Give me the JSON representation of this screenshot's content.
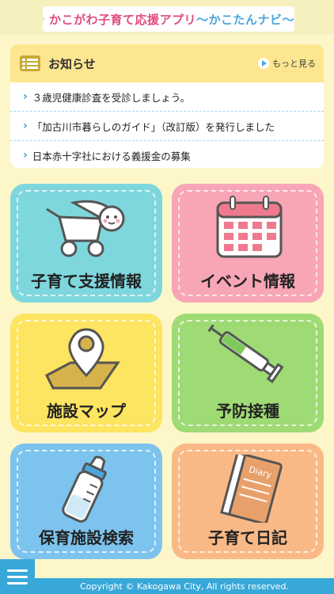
{
  "header": {
    "logo_main": "かこがわ子育て応援アプリ",
    "logo_sub": "〜かこたんナビ〜"
  },
  "notice": {
    "title": "お知らせ",
    "more_label": "もっと見る",
    "items": [
      {
        "text": "３歳児健康診査を受診しましょう。"
      },
      {
        "text": "「加古川市暮らしのガイド」（改訂版）を発行しました"
      },
      {
        "text": "日本赤十字社における義援金の募集"
      }
    ]
  },
  "tiles": [
    {
      "label": "子育て支援情報",
      "icon": "stroller-icon",
      "color": "#7ed7dd"
    },
    {
      "label": "イベント情報",
      "icon": "calendar-icon",
      "color": "#f8a5b6"
    },
    {
      "label": "施設マップ",
      "icon": "map-pin-icon",
      "color": "#fde461"
    },
    {
      "label": "予防接種",
      "icon": "syringe-icon",
      "color": "#9fdb75"
    },
    {
      "label": "保育施設検索",
      "icon": "baby-bottle-icon",
      "color": "#7cc3ee"
    },
    {
      "label": "子育て日記",
      "icon": "diary-icon",
      "color": "#f9b986"
    }
  ],
  "diary_cover_text": "Diary",
  "footer": {
    "copyright": "Copyright © Kakogawa City, All rights reserved."
  },
  "colors": {
    "accent": "#38a8d8",
    "notice_bar": "#fce68f",
    "background": "#fdf6c8"
  }
}
